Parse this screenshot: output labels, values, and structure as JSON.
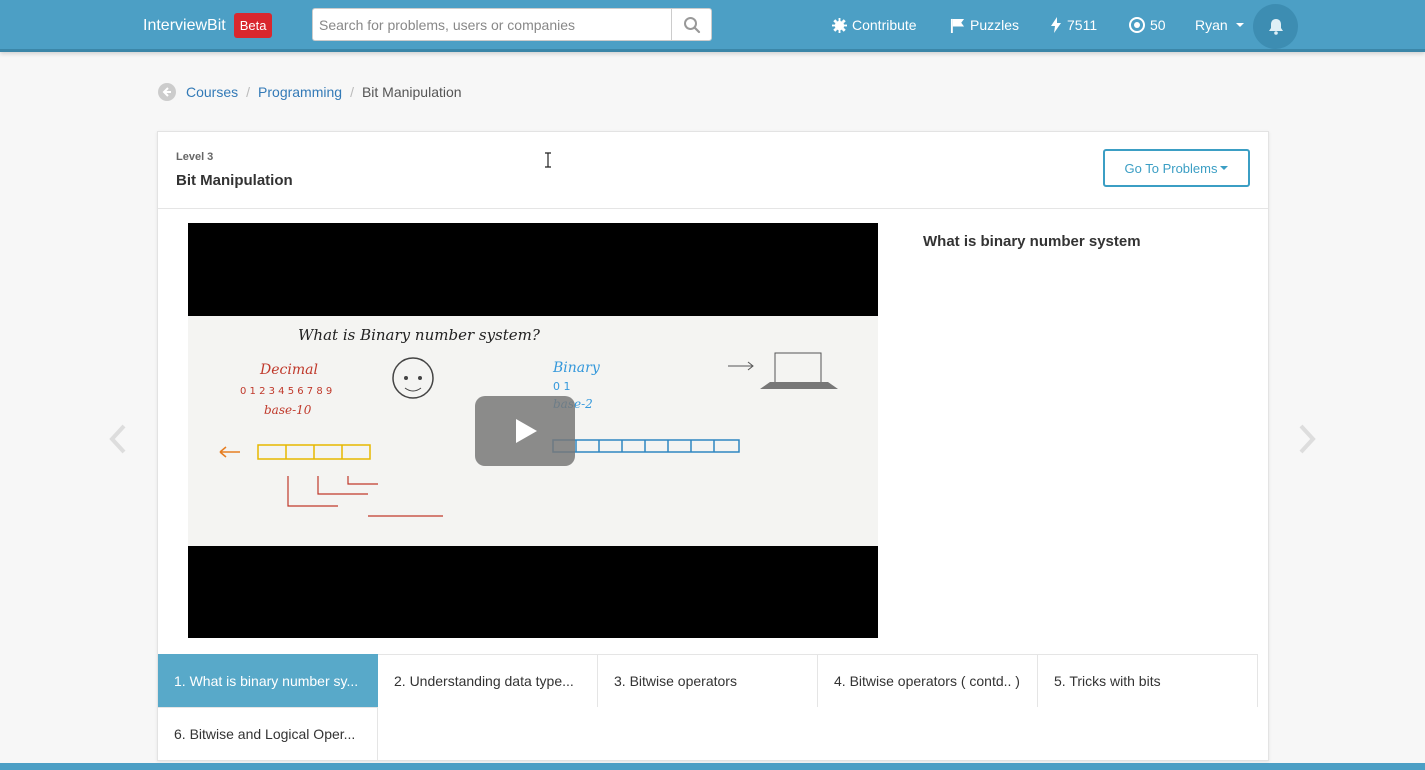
{
  "navbar": {
    "brand": "InterviewBit",
    "badge": "Beta",
    "search_placeholder": "Search for problems, users or companies",
    "contribute": "Contribute",
    "puzzles": "Puzzles",
    "points": "7511",
    "coins": "50",
    "user": "Ryan"
  },
  "breadcrumb": {
    "items": [
      "Courses",
      "Programming"
    ],
    "current": "Bit Manipulation"
  },
  "course": {
    "level": "Level 3",
    "title": "Bit Manipulation",
    "goto_label": "Go To Problems",
    "lesson_title": "What is binary number system",
    "video_text": {
      "heading": "What is Binary number system?",
      "decimal": "Decimal",
      "decimal_digits": "0 1 2 3 4 5 6 7 8 9",
      "base10": "base-10",
      "binary": "Binary",
      "binary_digits": "0 1",
      "base2": "base-2"
    }
  },
  "tabs": [
    {
      "label": "1. What is binary number sy...",
      "active": true
    },
    {
      "label": "2. Understanding data type...",
      "active": false
    },
    {
      "label": "3. Bitwise operators",
      "active": false
    },
    {
      "label": "4. Bitwise operators ( contd.. )",
      "active": false
    },
    {
      "label": "5. Tricks with bits",
      "active": false
    },
    {
      "label": "6. Bitwise and Logical Oper...",
      "active": false
    }
  ],
  "colors": {
    "navbar": "#4c9fc5",
    "accent": "#3b9ec4",
    "active_tab": "#58a9c9",
    "beta": "#d9272e"
  }
}
